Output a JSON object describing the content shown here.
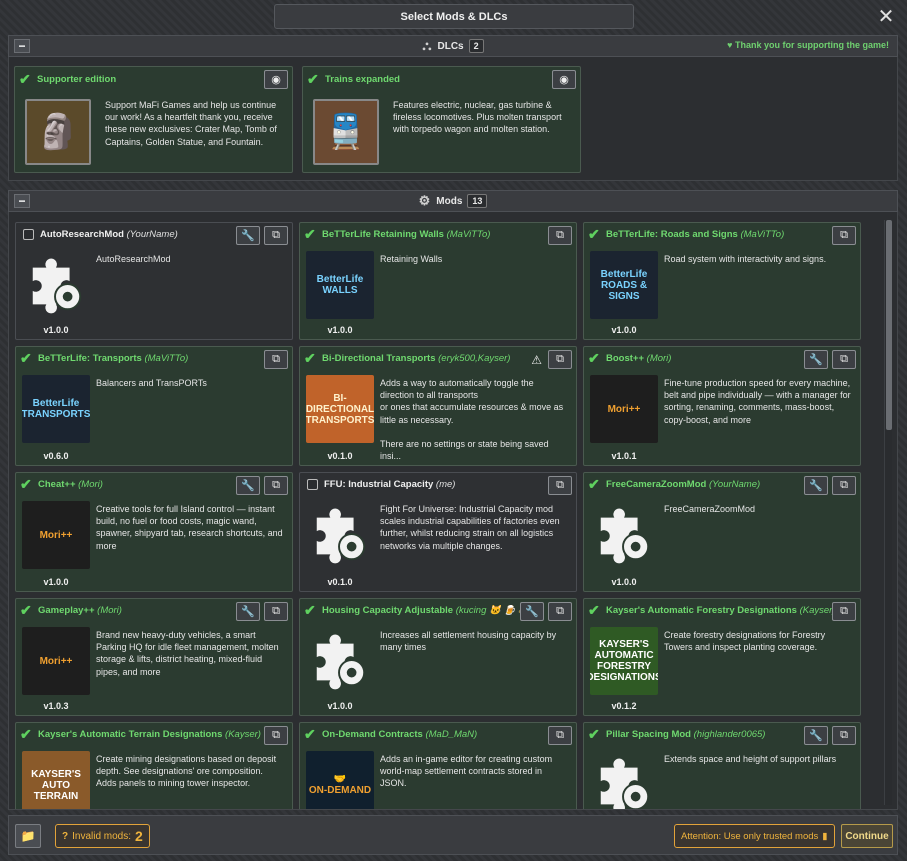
{
  "window": {
    "title": "Select Mods & DLCs",
    "close_icon": "✕"
  },
  "dlcs": {
    "header_label": "DLCs",
    "count": "2",
    "thanks": "♥ Thank you for supporting the game!",
    "items": [
      {
        "title": "Supporter edition",
        "desc": "Support MaFi Games and help us continue our work! As a heartfelt thank you, receive these new exclusives: Crater Map, Tomb of Captains, Golden Statue, and Fountain.",
        "thumb": "🗿",
        "thumb_bg": "#5b4a2a"
      },
      {
        "title": "Trains expanded",
        "desc": "Features electric, nuclear, gas turbine & fireless locomotives. Plus molten transport with torpedo wagon and molten station.",
        "thumb": "🚆",
        "thumb_bg": "#6b4a32"
      }
    ]
  },
  "mods": {
    "header_label": "Mods",
    "count": "13",
    "items": [
      {
        "title": "AutoResearchMod",
        "author": "(YourName)",
        "checked": false,
        "desc": "AutoResearchMod",
        "version": "v1.0.0",
        "thumb": "puzzle",
        "wrench": true
      },
      {
        "title": "BeTTerLife Retaining Walls",
        "author": "(MaViTTo)",
        "checked": true,
        "desc": "Retaining Walls",
        "version": "v1.0.0",
        "thumb": "BetterLife\nWALLS",
        "thumb_bg": "#1b2430",
        "thumb_fg": "#7ad3ff",
        "wrench": false
      },
      {
        "title": "BeTTerLife: Roads and Signs",
        "author": "(MaViTTo)",
        "checked": true,
        "desc": "Road system with interactivity and signs.",
        "version": "v1.0.0",
        "thumb": "BetterLife\nROADS & SIGNS",
        "thumb_bg": "#1b2430",
        "thumb_fg": "#7ad3ff",
        "wrench": false
      },
      {
        "title": "BeTTerLife: Transports",
        "author": "(MaViTTo)",
        "checked": true,
        "desc": "Balancers and TransPORTs",
        "version": "v0.6.0",
        "thumb": "BetterLife\nTRANSPORTS",
        "thumb_bg": "#1b2430",
        "thumb_fg": "#7ad3ff",
        "wrench": false
      },
      {
        "title": "Bi-Directional Transports",
        "author": "(eryk500,Kayser)",
        "checked": true,
        "desc": "Adds a way to automatically toggle the direction to all transports\nor ones that accumulate resources & move as little as necessary.\n\nThere are no settings or state being saved insi...",
        "version": "v0.1.0",
        "thumb": "BI-DIRECTIONAL\nTRANSPORTS",
        "thumb_bg": "#c0632a",
        "thumb_fg": "#fff2cc",
        "wrench": false,
        "warn": true
      },
      {
        "title": "Boost++",
        "author": "(Mori)",
        "checked": true,
        "desc": "Fine-tune production speed for every machine, belt and pipe individually — with a manager for sorting, renaming, comments, mass-boost, copy-boost, and more",
        "version": "v1.0.1",
        "thumb": "Mori++",
        "thumb_bg": "#1e1e1e",
        "thumb_fg": "#f0a030",
        "wrench": true
      },
      {
        "title": "Cheat++",
        "author": "(Mori)",
        "checked": true,
        "desc": "Creative tools for full Island control — instant build, no fuel or food costs, magic wand, spawner, shipyard tab, research shortcuts, and more",
        "version": "v1.0.0",
        "thumb": "Mori++",
        "thumb_bg": "#1e1e1e",
        "thumb_fg": "#f0a030",
        "wrench": true
      },
      {
        "title": "FFU: Industrial Capacity",
        "author": "(me)",
        "checked": false,
        "desc": "Fight For Universe: Industrial Capacity mod scales industrial capabilities of factories even further, whilst reducing strain on all logistics networks via multiple changes.",
        "version": "v0.1.0",
        "thumb": "puzzle",
        "wrench": false
      },
      {
        "title": "FreeCameraZoomMod",
        "author": "(YourName)",
        "checked": true,
        "desc": "FreeCameraZoomMod",
        "version": "v1.0.0",
        "thumb": "puzzle",
        "wrench": true
      },
      {
        "title": "Gameplay++",
        "author": "(Mori)",
        "checked": true,
        "desc": "Brand new heavy-duty vehicles, a smart Parking HQ for idle fleet management, molten storage & lifts, district heating, mixed-fluid pipes, and more",
        "version": "v1.0.3",
        "thumb": "Mori++",
        "thumb_bg": "#1e1e1e",
        "thumb_fg": "#f0a030",
        "wrench": true
      },
      {
        "title": "Housing Capacity Adjustable",
        "author": "(kucing 🐱 🍺 🐱)",
        "checked": true,
        "desc": "Increases all settlement housing capacity by many times",
        "version": "v1.0.0",
        "thumb": "puzzle",
        "wrench": true
      },
      {
        "title": "Kayser's Automatic Forestry Designations",
        "author": "(Kayser)",
        "checked": true,
        "desc": "Create forestry designations for Forestry Towers and inspect planting coverage.",
        "version": "v0.1.2",
        "thumb": "KAYSER'S\nAUTOMATIC\nFORESTRY\nDESIGNATIONS",
        "thumb_bg": "#2f5a24",
        "thumb_fg": "#ffffff",
        "wrench": false
      },
      {
        "title": "Kayser's Automatic Terrain Designations",
        "author": "(Kayser)",
        "checked": true,
        "desc": "Create mining designations based on deposit depth. See designations' ore composition. Adds panels to mining tower inspector.",
        "version": "",
        "thumb": "KAYSER'S\nAUTO TERRAIN",
        "thumb_bg": "#8a5a2a",
        "thumb_fg": "#ffffff",
        "wrench": false
      },
      {
        "title": "On-Demand Contracts",
        "author": "(MaD_MaN)",
        "checked": true,
        "desc": "Adds an in-game editor for creating custom world-map settlement contracts stored in JSON.",
        "version": "",
        "thumb": "🤝\nON-DEMAND",
        "thumb_bg": "#10202e",
        "thumb_fg": "#f0a030",
        "wrench": false
      },
      {
        "title": "Pillar Spacing Mod",
        "author": "(highlander0065)",
        "checked": true,
        "desc": "Extends space and height of support pillars",
        "version": "",
        "thumb": "puzzle",
        "wrench": true
      }
    ]
  },
  "footer": {
    "folder_icon": "📁",
    "invalid_label": "Invalid mods:",
    "invalid_count": "2",
    "attention": "Attention: Use only trusted mods",
    "continue": "Continue"
  }
}
